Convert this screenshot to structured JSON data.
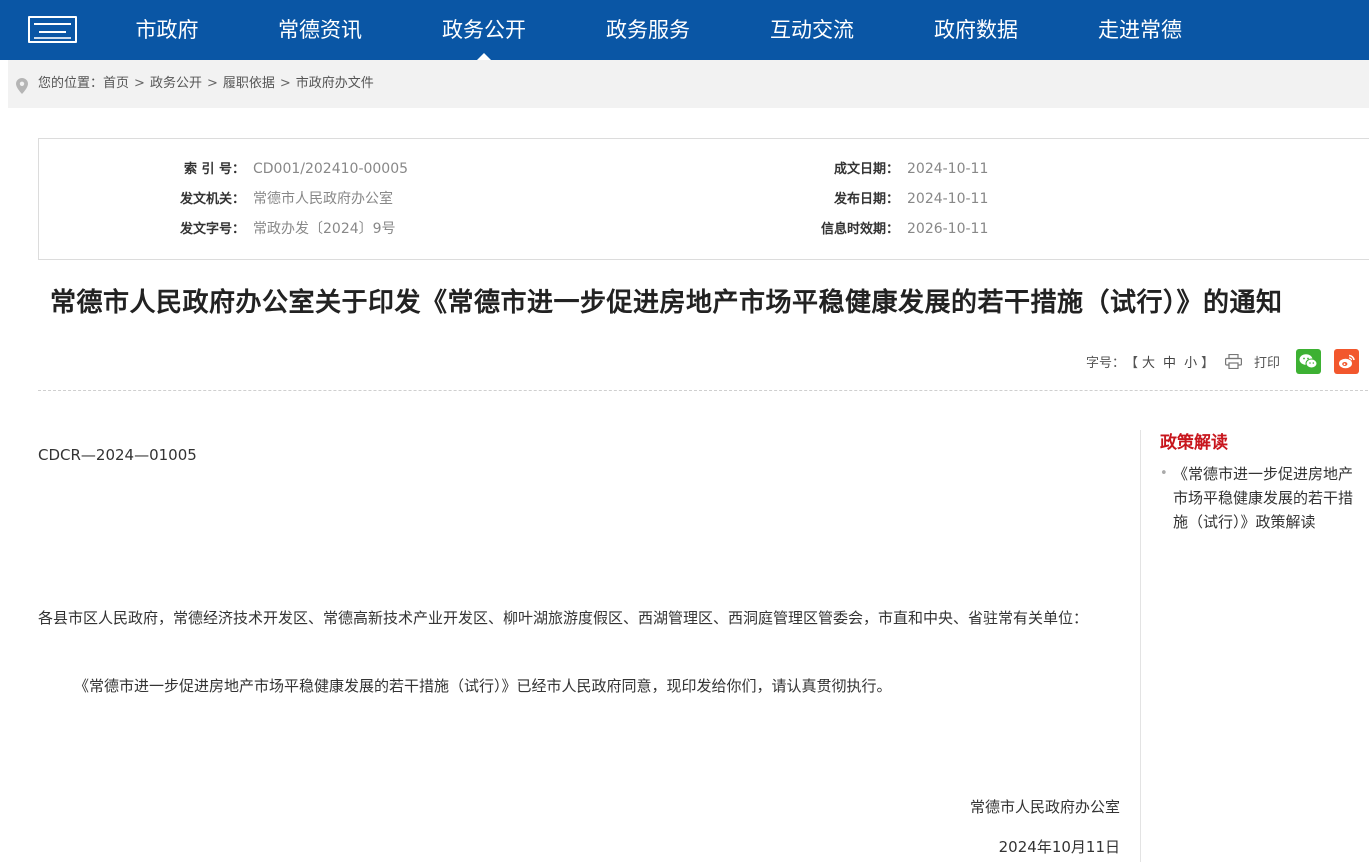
{
  "nav": {
    "items": [
      {
        "label": "市政府",
        "active": false
      },
      {
        "label": "常德资讯",
        "active": false
      },
      {
        "label": "政务公开",
        "active": true
      },
      {
        "label": "政务服务",
        "active": false
      },
      {
        "label": "互动交流",
        "active": false
      },
      {
        "label": "政府数据",
        "active": false
      },
      {
        "label": "走进常德",
        "active": false
      }
    ],
    "color": "#0a56a5"
  },
  "breadcrumb": {
    "prefix": "您的位置：",
    "items": [
      "首页",
      "政务公开",
      "履职依据",
      "市政府办文件"
    ],
    "separator": ">"
  },
  "info": {
    "index_label": "索 引 号：",
    "index_value": "CD001/202410-00005",
    "issuer_label": "发文机关：",
    "issuer_value": "常德市人民政府办公室",
    "docnum_label": "发文字号：",
    "docnum_value": "常政办发〔2024〕9号",
    "created_label": "成文日期：",
    "created_value": "2024-10-11",
    "published_label": "发布日期：",
    "published_value": "2024-10-11",
    "expiry_label": "信息时效期：",
    "expiry_value": "2026-10-11"
  },
  "title": "常德市人民政府办公室关于印发《常德市进一步促进房地产市场平稳健康发展的若干措施（试行）》的通知",
  "tools": {
    "fontsize_label": "字号：",
    "bracket_open": "【",
    "bracket_close": "】",
    "large": "大",
    "medium": "中",
    "small": "小",
    "print": "打印",
    "wechat_color": "#3db133",
    "weibo_color": "#f2572d"
  },
  "body": {
    "doc_code": "CDCR—2024—01005",
    "addressee": "各县市区人民政府，常德经济技术开发区、常德高新技术产业开发区、柳叶湖旅游度假区、西湖管理区、西洞庭管理区管委会，市直和中央、省驻常有关单位：",
    "paragraph": "《常德市进一步促进房地产市场平稳健康发展的若干措施（试行）》已经市人民政府同意，现印发给你们，请认真贯彻执行。",
    "signer": "常德市人民政府办公室",
    "date": "2024年10月11日"
  },
  "sidebar": {
    "title": "政策解读",
    "title_color": "#c8161d",
    "items": [
      "《常德市进一步促进房地产市场平稳健康发展的若干措施（试行）》政策解读"
    ]
  }
}
